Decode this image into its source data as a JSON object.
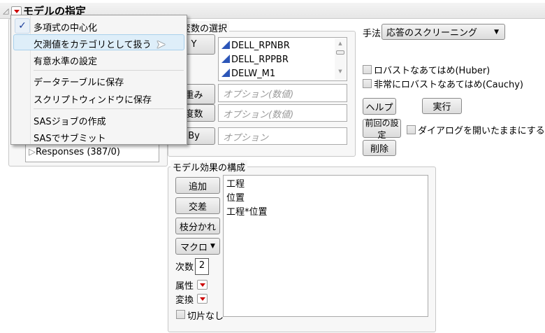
{
  "header": {
    "title": "モデルの指定"
  },
  "menu": {
    "items": [
      {
        "label": "多項式の中心化",
        "checked": true
      },
      {
        "label": "欠測値をカテゴリとして扱う",
        "highlighted": true
      },
      {
        "label": "有意水準の設定"
      },
      {
        "label": "データテーブルに保存"
      },
      {
        "label": "スクリプトウィンドウに保存"
      },
      {
        "label": "SASジョブの作成"
      },
      {
        "label": "SASでサブミット"
      }
    ]
  },
  "columns": {
    "responses": "Responses (387/0)"
  },
  "roles": {
    "title": "列変数の選択",
    "y_label": "Y",
    "y_values": [
      "DELL_RPNBR",
      "DELL_RPPBR",
      "DELW_M1"
    ],
    "weight_label": "重み",
    "weight_placeholder": "オプション(数値)",
    "freq_label": "度数",
    "freq_placeholder": "オプション(数値)",
    "by_label": "By",
    "by_placeholder": "オプション"
  },
  "method": {
    "label": "手法:",
    "value": "応答のスクリーニング"
  },
  "options": {
    "huber": "ロバストなあてはめ(Huber)",
    "cauchy": "非常にロバストなあてはめ(Cauchy)",
    "keep_open": "ダイアログを開いたままにする"
  },
  "actions": {
    "help": "ヘルプ",
    "run": "実行",
    "recall": "前回の設定",
    "remove": "削除"
  },
  "effects": {
    "title": "モデル効果の構成",
    "add": "追加",
    "cross": "交差",
    "nest": "枝分かれ",
    "macros": "マクロ",
    "degree_label": "次数",
    "degree_value": "2",
    "attributes_label": "属性",
    "transform_label": "変換",
    "no_intercept": "切片なし",
    "list": [
      "工程",
      "位置",
      "工程*位置"
    ]
  }
}
